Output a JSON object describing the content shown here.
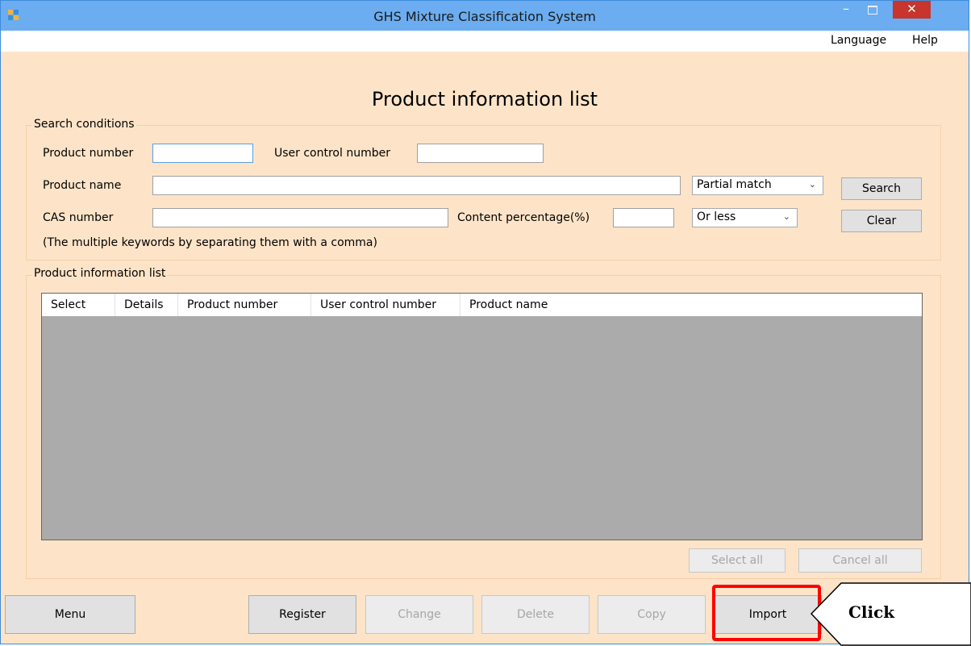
{
  "window": {
    "title": "GHS Mixture Classification System",
    "minimize_glyph": "–",
    "close_glyph": "✕"
  },
  "menu": {
    "language": "Language",
    "help": "Help"
  },
  "page": {
    "title": "Product information list"
  },
  "search": {
    "group_label": "Search conditions",
    "product_number_label": "Product number",
    "product_number_value": "",
    "user_control_number_label": "User control number",
    "user_control_number_value": "",
    "product_name_label": "Product name",
    "product_name_value": "",
    "match_mode": "Partial match",
    "cas_number_label": "CAS number",
    "cas_number_value": "",
    "content_percentage_label": "Content percentage(%)",
    "content_percentage_value": "",
    "comparison": "Or less",
    "hint": "(The multiple keywords by separating them with a comma)",
    "search_button": "Search",
    "clear_button": "Clear"
  },
  "list": {
    "group_label": "Product information list",
    "columns": [
      "Select",
      "Details",
      "Product number",
      "User control number",
      "Product name"
    ],
    "rows": [],
    "select_all_button": "Select all",
    "cancel_all_button": "Cancel all"
  },
  "actions": {
    "menu": "Menu",
    "register": "Register",
    "change": "Change",
    "delete": "Delete",
    "copy": "Copy",
    "import": "Import"
  },
  "annotation": {
    "callout": "Click",
    "highlight_color": "#ff0000"
  },
  "colors": {
    "titlebar": "#6badf0",
    "client_background": "#fde4c8",
    "close_button": "#c7352c",
    "grid_background": "#ababab"
  },
  "icons": {
    "app": "app-icon",
    "minimize": "minimize-icon",
    "maximize": "maximize-icon",
    "close": "close-icon",
    "dropdown": "chevron-down-icon"
  }
}
